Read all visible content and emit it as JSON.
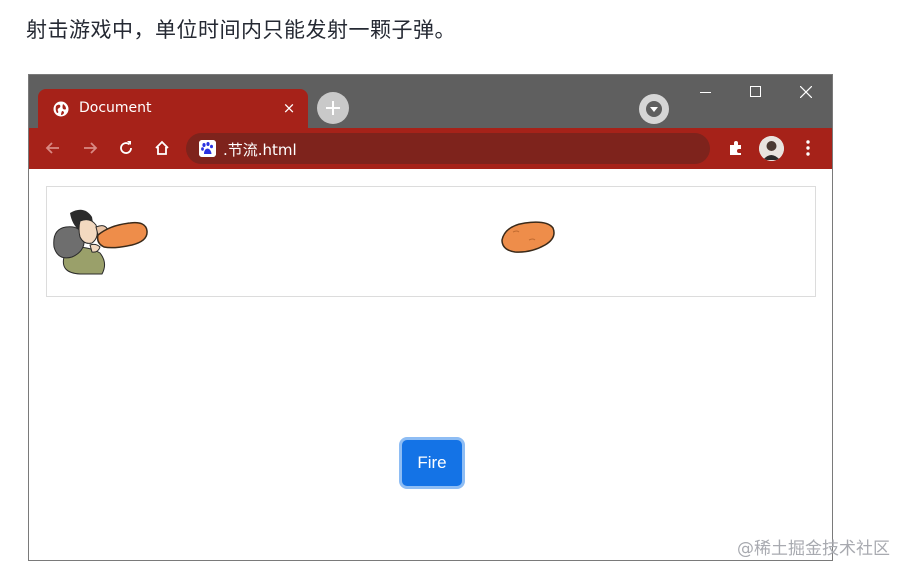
{
  "article": {
    "text": "射击游戏中，单位时间内只能发射一颗子弹。"
  },
  "browser": {
    "tab": {
      "title": "Document",
      "close_label": "×"
    },
    "address_bar": {
      "url": ".节流.html"
    }
  },
  "page": {
    "fire_button_label": "Fire"
  },
  "watermark": "@稀土掘金技术社区",
  "colors": {
    "tab_strip": "#5f5f5f",
    "toolbar": "#a62219",
    "omnibox": "#7e231c",
    "fire_button": "#1473e6",
    "bullet": "#ee8d4a"
  },
  "icons": {
    "tab_favicon": "globe-icon",
    "new_tab": "plus-icon",
    "tab_search": "chevron-down-icon",
    "back": "arrow-left-icon",
    "forward": "arrow-right-icon",
    "reload": "reload-icon",
    "home": "home-icon",
    "site": "baidu-paw-icon",
    "extensions": "puzzle-icon",
    "profile": "avatar-icon",
    "menu": "kebab-menu-icon"
  }
}
